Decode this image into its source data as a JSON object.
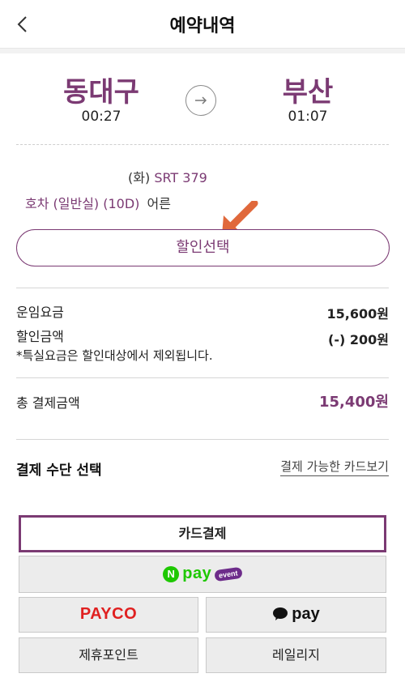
{
  "header": {
    "title": "예약내역"
  },
  "route": {
    "departure": {
      "station": "동대구",
      "time": "00:27"
    },
    "arrival": {
      "station": "부산",
      "time": "01:07"
    }
  },
  "train": {
    "day_prefix": "(화)",
    "train_no": "SRT 379",
    "car_info": "호차 (일반실) (10D)",
    "passenger_type": "어른"
  },
  "discount": {
    "button_label": "할인선택"
  },
  "fees": {
    "fare_label": "운임요금",
    "fare_value": "15,600원",
    "discount_label": "할인금액",
    "discount_value": "(-) 200원",
    "note": "*특실요금은 할인대상에서 제외됩니다.",
    "total_label": "총 결제금액",
    "total_value": "15,400원"
  },
  "payment": {
    "section_title": "결제 수단 선택",
    "card_link": "결제 가능한 카드보기",
    "methods": {
      "card": "카드결제",
      "npay_n": "N",
      "npay": "pay",
      "npay_event": "event",
      "payco": "PAYCO",
      "kakaopay": "pay",
      "partner_points": "제휴포인트",
      "mileage": "레일리지"
    }
  },
  "colors": {
    "accent": "#7b3a73",
    "pointer": "#e0683b",
    "npay_green": "#1ec800",
    "payco_red": "#e02020"
  }
}
